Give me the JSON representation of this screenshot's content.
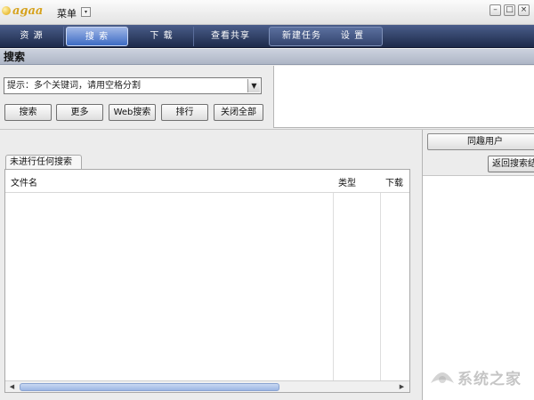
{
  "app": {
    "logo_text": "agaa",
    "menu_label": "菜单",
    "menu_dropdown": "▾",
    "window_buttons": {
      "minimize": "–",
      "maximize": "□",
      "close": "×"
    }
  },
  "tabs": [
    {
      "label": "资 源"
    },
    {
      "label": "搜 索",
      "active": true
    },
    {
      "label": "下 载"
    },
    {
      "label": "查看共享"
    },
    {
      "label": "新建任务"
    },
    {
      "label": "设 置"
    }
  ],
  "section": {
    "title": "搜索"
  },
  "search": {
    "hint": "提示：多个关键词，请用空格分割",
    "dropdown_arrow": "▼",
    "buttons": [
      "搜索",
      "更多",
      "Web搜索",
      "排行",
      "关闭全部"
    ]
  },
  "results": {
    "tab_label": "未进行任何搜索",
    "columns": [
      "文件名",
      "类型",
      "下载"
    ],
    "rows": [],
    "scroll_left": "◀",
    "scroll_right": "▶"
  },
  "right_panel": {
    "peer_button": "同趣用户",
    "back_button": "返回搜索结"
  },
  "watermark": {
    "text": "系统之家"
  },
  "colors": {
    "tabbar": "#1d2a4a",
    "active_tab": "#3d6bc4",
    "section_header": "#aeb6c6"
  }
}
